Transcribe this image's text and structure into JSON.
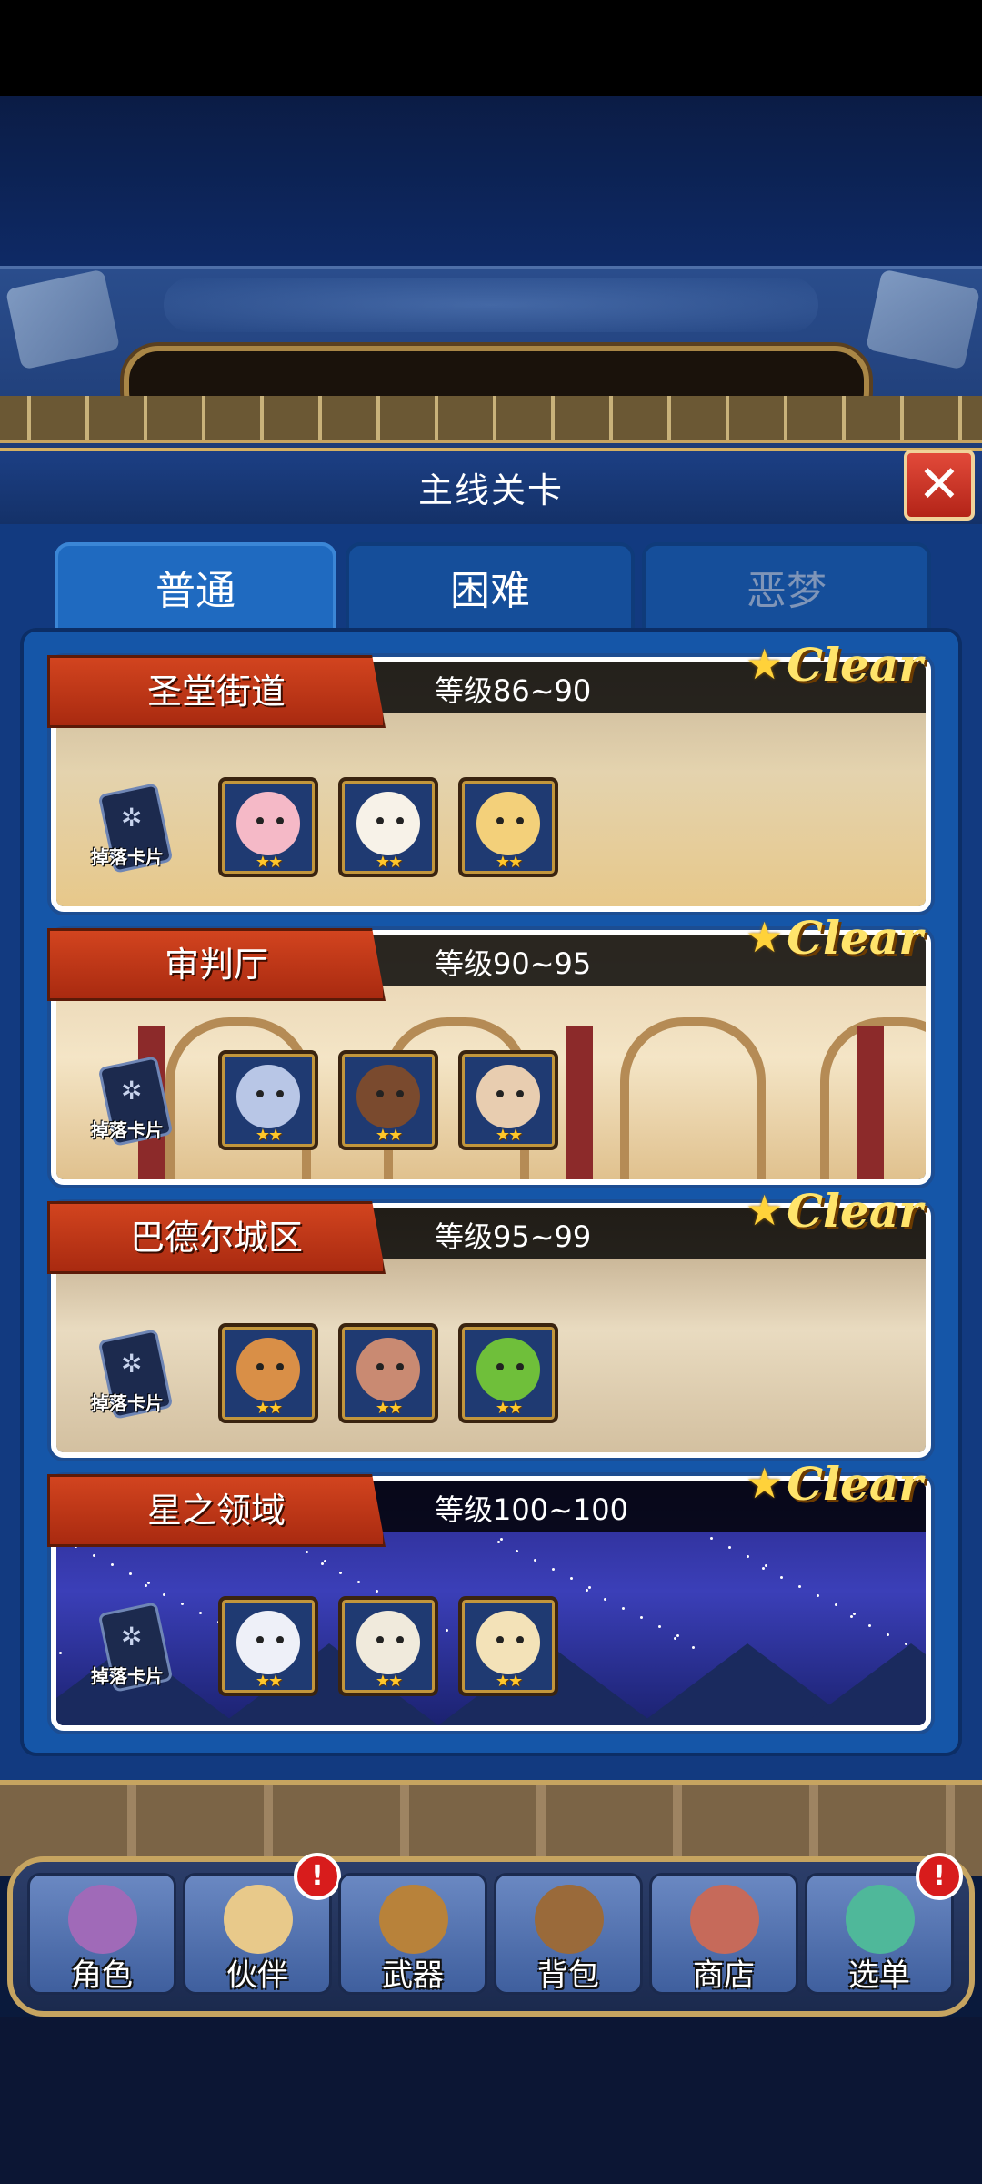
{
  "header": {
    "title": "主线关卡"
  },
  "tabs": [
    {
      "label": "普通",
      "active": true
    },
    {
      "label": "困难",
      "active": false
    },
    {
      "label": "恶梦",
      "active": false
    }
  ],
  "stages": [
    {
      "name": "圣堂街道",
      "level": "等级86~90",
      "clear": "Clear",
      "drop_label": "掉落卡片",
      "monsters": [
        {
          "name": "axolotl",
          "color": "#f5b9c7",
          "stars": "★★"
        },
        {
          "name": "chicken",
          "color": "#f7f2e8",
          "stars": "★★"
        },
        {
          "name": "blonde-girl",
          "color": "#f3d07a",
          "stars": "★★"
        }
      ]
    },
    {
      "name": "审判厅",
      "level": "等级90~95",
      "clear": "Clear",
      "drop_label": "掉落卡片",
      "monsters": [
        {
          "name": "silver-hair-girl",
          "color": "#b8c6e6",
          "stars": "★★"
        },
        {
          "name": "nurse-girl",
          "color": "#7a4a2e",
          "stars": "★★"
        },
        {
          "name": "owl",
          "color": "#e8cdb0",
          "stars": "★★"
        }
      ]
    },
    {
      "name": "巴德尔城区",
      "level": "等级95~99",
      "clear": "Clear",
      "drop_label": "掉落卡片",
      "monsters": [
        {
          "name": "onion",
          "color": "#d98f47",
          "stars": "★★"
        },
        {
          "name": "hamster",
          "color": "#c98a72",
          "stars": "★★"
        },
        {
          "name": "bush",
          "color": "#6fbf3a",
          "stars": "★★"
        }
      ]
    },
    {
      "name": "星之领域",
      "level": "等级100~100",
      "clear": "Clear",
      "drop_label": "掉落卡片",
      "monsters": [
        {
          "name": "white-fox",
          "color": "#eef0f8",
          "stars": "★★"
        },
        {
          "name": "candle",
          "color": "#f0eadc",
          "stars": "★★"
        },
        {
          "name": "winged-cat",
          "color": "#f3e2b8",
          "stars": "★★"
        }
      ]
    }
  ],
  "nav": [
    {
      "label": "角色",
      "icon": "character-icon",
      "badge": ""
    },
    {
      "label": "伙伴",
      "icon": "partner-icon",
      "badge": "!"
    },
    {
      "label": "武器",
      "icon": "weapon-icon",
      "badge": ""
    },
    {
      "label": "背包",
      "icon": "backpack-icon",
      "badge": ""
    },
    {
      "label": "商店",
      "icon": "shop-icon",
      "badge": ""
    },
    {
      "label": "选单",
      "icon": "menu-icon",
      "badge": "!"
    }
  ],
  "colors": {
    "accent": "#d4b062",
    "ribbon": "#c63a18",
    "clear": "#ffe46b"
  }
}
